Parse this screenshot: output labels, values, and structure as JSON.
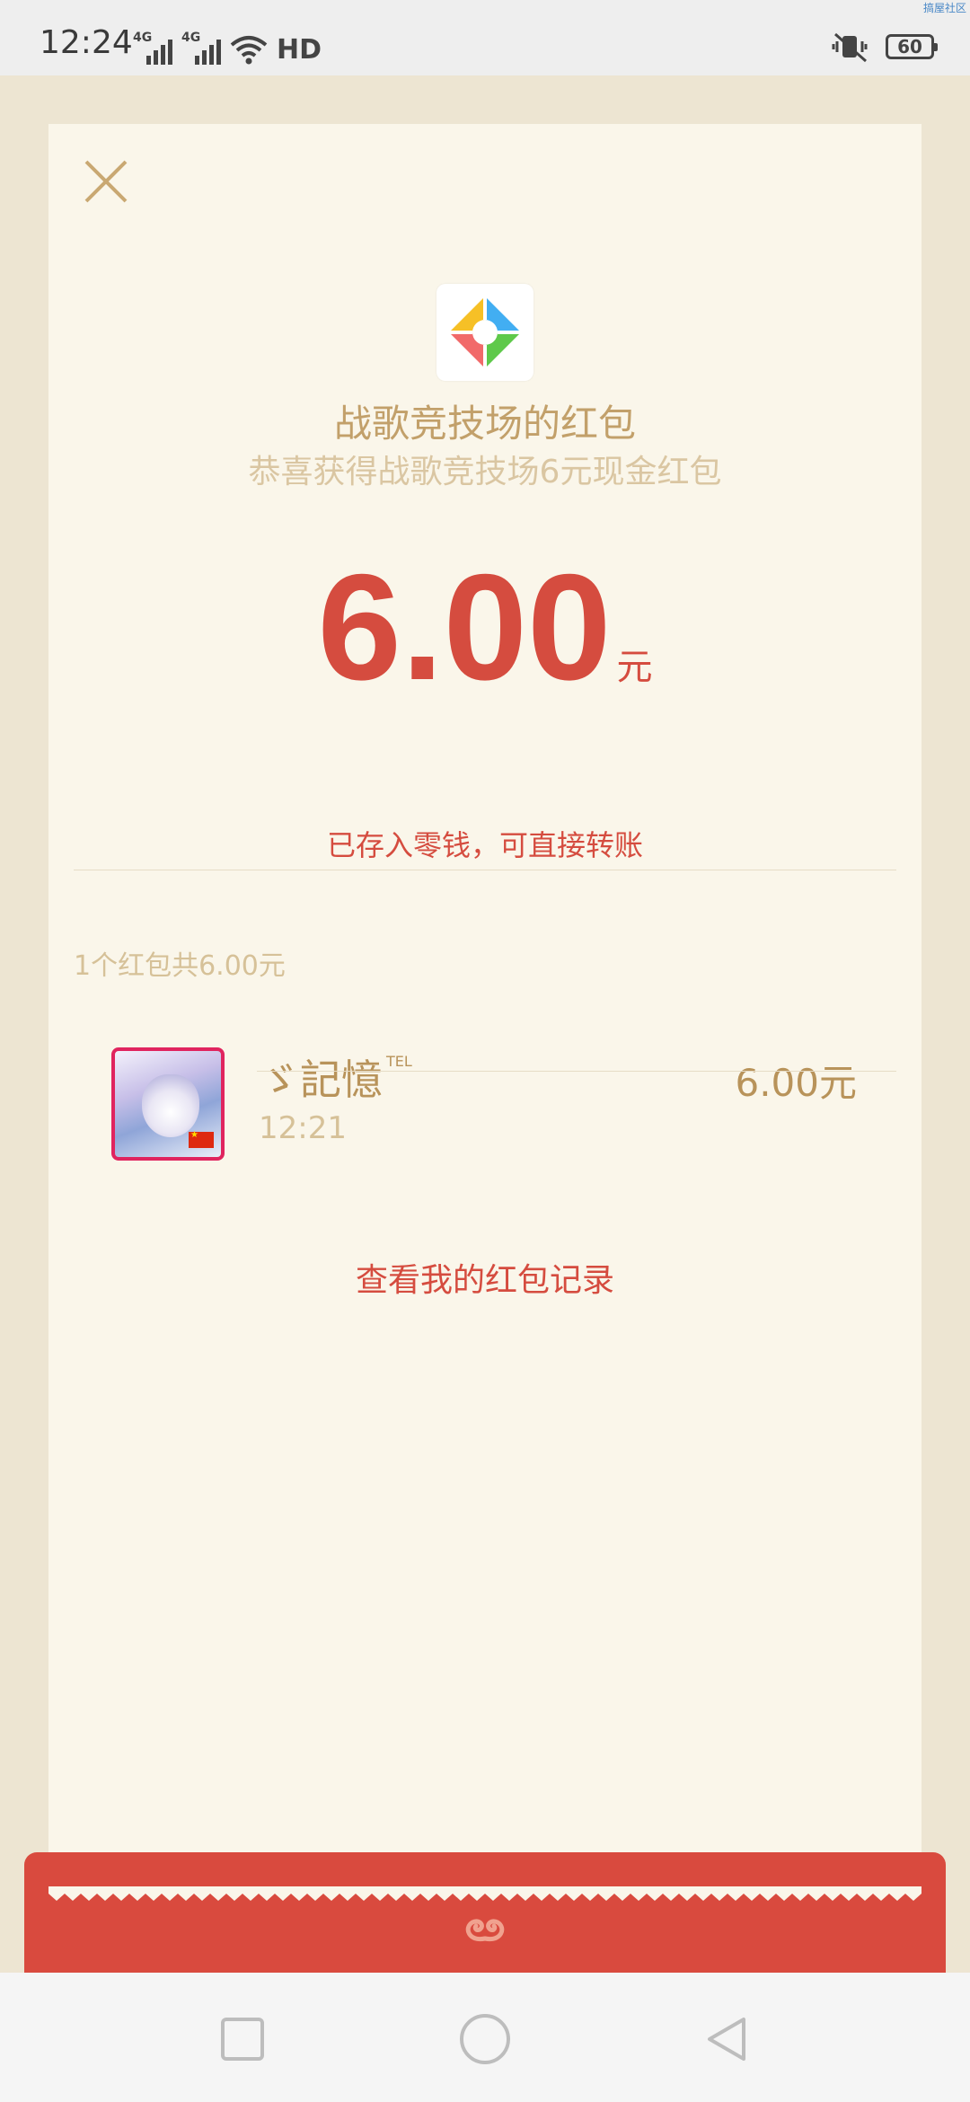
{
  "status_bar": {
    "time": "12:24",
    "network1": "4G",
    "network2": "4G",
    "hd": "HD",
    "battery": "60",
    "watermark": "搞屋社区"
  },
  "red_packet": {
    "sender_title": "战歌竞技场的红包",
    "subtitle": "恭喜获得战歌竞技场6元现金红包",
    "amount": "6.00",
    "unit": "元",
    "saved_note": "已存入零钱，可直接转账",
    "summary": "1个红包共6.00元"
  },
  "recipients": [
    {
      "name": "ゞ記憶",
      "name_sup": "TEL",
      "time": "12:21",
      "amount": "6.00元"
    }
  ],
  "actions": {
    "view_records": "查看我的红包记录"
  },
  "colors": {
    "accent_red": "#d54c3f",
    "gold": "#c2a06a",
    "card_bg": "#faf6ea"
  },
  "icons": {
    "close": "close-icon",
    "app_logo": "app-logo-icon",
    "swirl": "swirl-icon",
    "nav_recent": "square-icon",
    "nav_home": "circle-icon",
    "nav_back": "triangle-back-icon"
  }
}
